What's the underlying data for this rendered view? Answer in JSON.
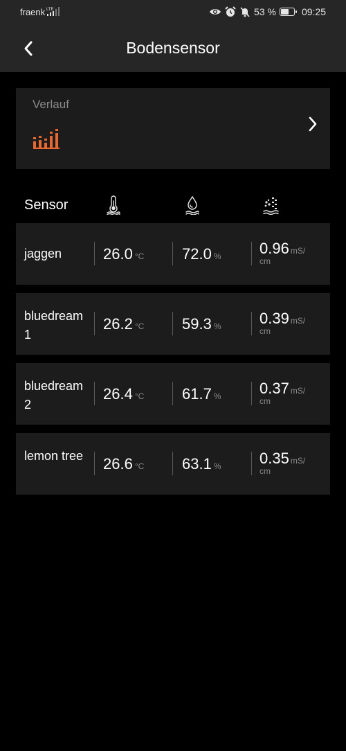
{
  "status": {
    "carrier": "fraenk",
    "network": "LTE",
    "battery_percent": "53 %",
    "battery_level": 0.53,
    "time": "09:25"
  },
  "header": {
    "title": "Bodensensor",
    "back_icon": "chevron-left-icon"
  },
  "history": {
    "label": "Verlauf",
    "icon": "bar-chart-icon",
    "accent_color": "#e8682f",
    "chevron_icon": "chevron-right-icon"
  },
  "table": {
    "sensor_header": "Sensor",
    "columns": [
      {
        "icon": "thermometer-icon"
      },
      {
        "icon": "humidity-drop-icon"
      },
      {
        "icon": "conductivity-icon"
      }
    ],
    "rows": [
      {
        "name": "jaggen",
        "temp": "26.0",
        "temp_unit": "°C",
        "humidity": "72.0",
        "humidity_unit": "%",
        "ec": "0.96",
        "ec_unit_a": "mS/",
        "ec_unit_b": "cm"
      },
      {
        "name": "bluedream 1",
        "temp": "26.2",
        "temp_unit": "°C",
        "humidity": "59.3",
        "humidity_unit": "%",
        "ec": "0.39",
        "ec_unit_a": "mS/",
        "ec_unit_b": "cm"
      },
      {
        "name": "bluedream 2",
        "temp": "26.4",
        "temp_unit": "°C",
        "humidity": "61.7",
        "humidity_unit": "%",
        "ec": "0.37",
        "ec_unit_a": "mS/",
        "ec_unit_b": "cm"
      },
      {
        "name": "lemon tree",
        "temp": "26.6",
        "temp_unit": "°C",
        "humidity": "63.1",
        "humidity_unit": "%",
        "ec": "0.35",
        "ec_unit_a": "mS/",
        "ec_unit_b": "cm"
      }
    ]
  }
}
